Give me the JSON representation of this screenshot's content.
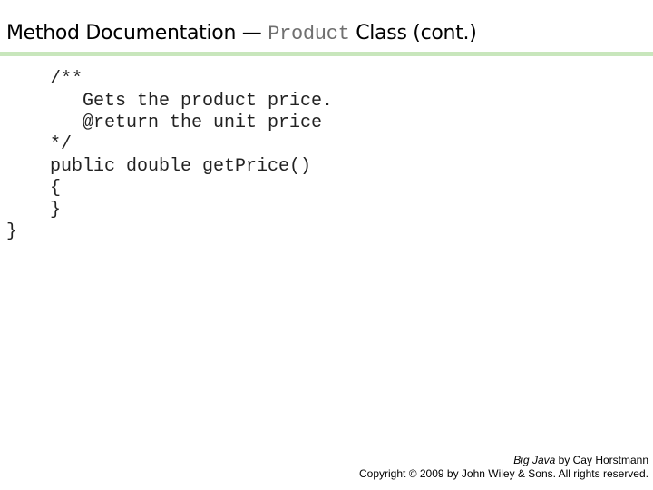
{
  "title": {
    "prefix": "Method Documentation — ",
    "code": "Product",
    "suffix": " Class (cont.)"
  },
  "colors": {
    "rule": "#c8e6bc",
    "title_code": "#707070"
  },
  "code_lines": [
    "    /**",
    "       Gets the product price.",
    "       @return the unit price",
    "    */",
    "    public double getPrice()",
    "    {",
    "    }",
    "}"
  ],
  "footer": {
    "book_title": "Big Java",
    "by_author": " by Cay Horstmann",
    "copyright": "Copyright © 2009 by John Wiley & Sons.  All rights reserved."
  }
}
